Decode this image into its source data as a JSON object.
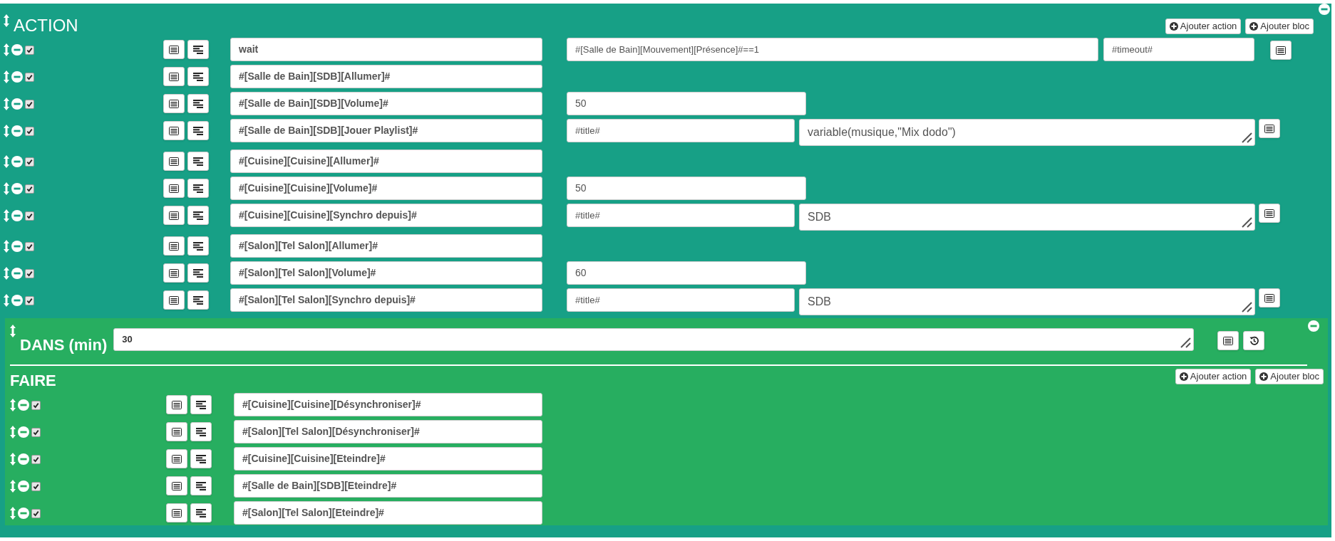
{
  "action_block": {
    "title": "ACTION",
    "buttons": [
      "Ajouter action",
      "Ajouter bloc"
    ],
    "rows": [
      {
        "kind": "wait",
        "enabled": true,
        "command": "wait",
        "condition": "#[Salle de Bain][Mouvement][Présence]#==1",
        "timeout": "#timeout#"
      },
      {
        "kind": "plain",
        "enabled": true,
        "command": "#[Salle de Bain][SDB][Allumer]#"
      },
      {
        "kind": "value",
        "enabled": true,
        "command": "#[Salle de Bain][SDB][Volume]#",
        "value": "50"
      },
      {
        "kind": "message",
        "enabled": true,
        "command": "#[Salle de Bain][SDB][Jouer Playlist]#",
        "title": "#title#",
        "message": "variable(musique,\"Mix dodo\")"
      },
      {
        "kind": "plain",
        "enabled": true,
        "command": "#[Cuisine][Cuisine][Allumer]#"
      },
      {
        "kind": "value",
        "enabled": true,
        "command": "#[Cuisine][Cuisine][Volume]#",
        "value": "50"
      },
      {
        "kind": "message",
        "enabled": true,
        "command": "#[Cuisine][Cuisine][Synchro depuis]#",
        "title": "#title#",
        "message": "SDB"
      },
      {
        "kind": "plain",
        "enabled": true,
        "command": "#[Salon][Tel Salon][Allumer]#"
      },
      {
        "kind": "value",
        "enabled": true,
        "command": "#[Salon][Tel Salon][Volume]#",
        "value": "60"
      },
      {
        "kind": "message",
        "enabled": true,
        "command": "#[Salon][Tel Salon][Synchro depuis]#",
        "title": "#title#",
        "message": "SDB"
      }
    ]
  },
  "delay_block": {
    "label": "DANS (min)",
    "value": "30",
    "section": "FAIRE",
    "buttons": [
      "Ajouter action",
      "Ajouter bloc"
    ],
    "rows": [
      {
        "enabled": true,
        "command": "#[Cuisine][Cuisine][Désynchroniser]#"
      },
      {
        "enabled": true,
        "command": "#[Salon][Tel Salon][Désynchroniser]#"
      },
      {
        "enabled": true,
        "command": "#[Cuisine][Cuisine][Eteindre]#"
      },
      {
        "enabled": true,
        "command": "#[Salle de Bain][SDB][Eteindre]#"
      },
      {
        "enabled": true,
        "command": "#[Salon][Tel Salon][Eteindre]#"
      }
    ]
  }
}
